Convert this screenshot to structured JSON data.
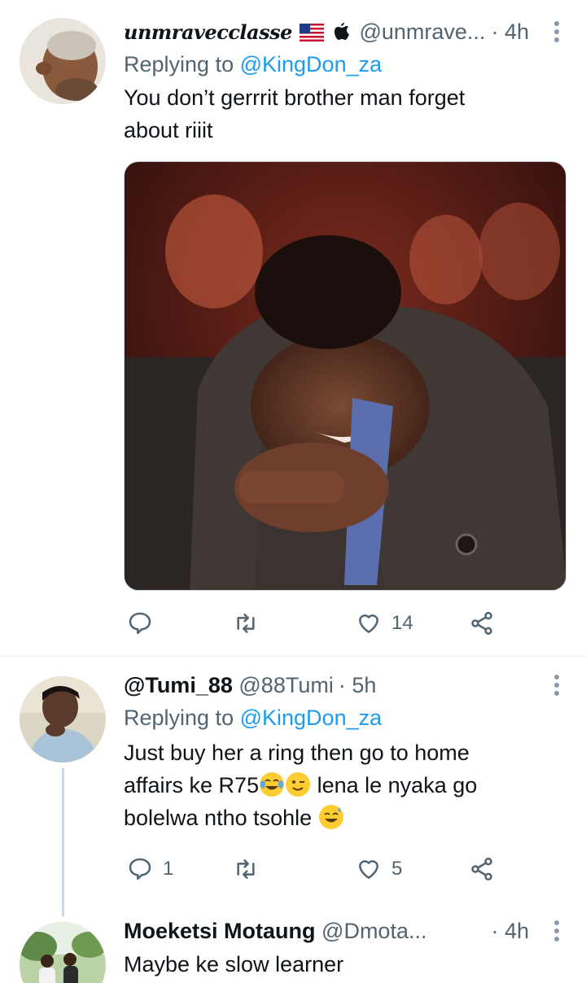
{
  "tweets": [
    {
      "display_name": "unmravecclasse",
      "handle": "@unmrave...",
      "time": "· 4h",
      "reply_label": "Replying to",
      "reply_mention": "@KingDon_za",
      "text": "You don’t gerrrit brother man forget about riiit",
      "actions": {
        "reply": "",
        "retweet": "",
        "like": "14"
      }
    },
    {
      "display_name": "@Tumi_88",
      "handle": "@88Tumi",
      "time": "· 5h",
      "reply_label": "Replying to",
      "reply_mention": "@KingDon_za",
      "text_part1": "Just buy her a ring then go to home affairs ke R75",
      "text_part2": " lena le nyaka go bolelwa ntho tsohle ",
      "actions": {
        "reply": "1",
        "retweet": "",
        "like": "5"
      }
    },
    {
      "display_name": "Moeketsi Motaung",
      "handle": "@Dmota...",
      "time": "· 4h",
      "text": "Maybe ke slow learner"
    }
  ],
  "icons": {
    "flag": "us-flag-icon",
    "apple": "apple-icon",
    "reply": "reply-icon",
    "retweet": "retweet-icon",
    "like": "heart-icon",
    "share": "share-icon",
    "more": "more-icon"
  },
  "colors": {
    "link": "#1d9bf0",
    "secondary": "#536471",
    "primary": "#0f1419"
  }
}
